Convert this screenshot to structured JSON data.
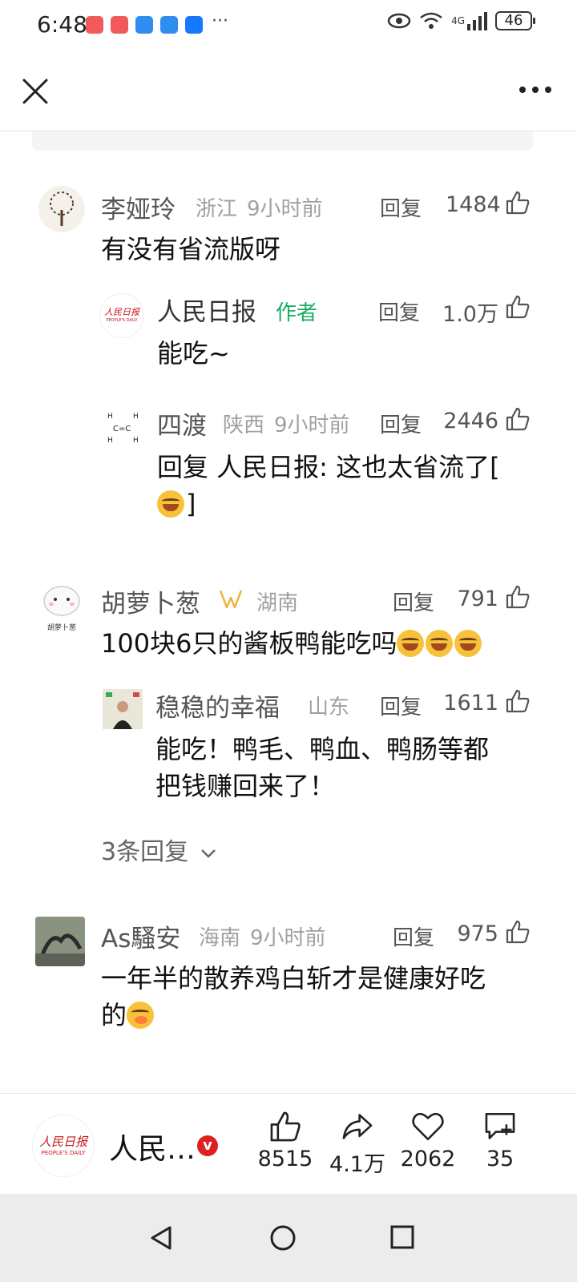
{
  "status": {
    "time": "6:48",
    "battery": "46",
    "network": "4G"
  },
  "comments": [
    {
      "user": "李娅玲",
      "location": "浙江",
      "time": "9小时前",
      "reply_label": "回复",
      "likes": "1484",
      "text": "有没有省流版呀"
    },
    {
      "user": "人民日报",
      "author_tag": "作者",
      "reply_label": "回复",
      "likes": "1.0万",
      "text": "能吃~"
    },
    {
      "user": "四渡",
      "location": "陕西",
      "time": "9小时前",
      "reply_label": "回复",
      "likes": "2446",
      "text": "回复 人民日报: 这也太省流了[",
      "text_line2": "]"
    },
    {
      "user": "胡萝卜葱",
      "location": "湖南",
      "reply_label": "回复",
      "likes": "791",
      "text": "100块6只的酱板鸭能吃吗"
    },
    {
      "user": "稳稳的幸福",
      "location": "山东",
      "reply_label": "回复",
      "likes": "1611",
      "text": "能吃！鸭毛、鸭血、鸭肠等都",
      "text_line2": "把钱赚回来了！"
    },
    {
      "user": "As騷安",
      "location": "海南",
      "time": "9小时前",
      "reply_label": "回复",
      "likes": "975",
      "text": "一年半的散养鸡白斩才是健康好吃",
      "text_line2": "的"
    }
  ],
  "more_replies": "3条回复",
  "bottom_bar": {
    "publisher": "人民…",
    "verified_badge": "v",
    "like_count": "8515",
    "share_count": "4.1万",
    "fav_count": "2062",
    "comment_count": "35"
  },
  "avatar_texts": {
    "renmin": "人民日报",
    "renmin_en": "PEOPLE'S DAILY",
    "carrot": "胡萝卜葱"
  },
  "colors": {
    "author_green": "#1aad62",
    "badge_red": "#e02020",
    "brand_red": "#c8161d"
  }
}
